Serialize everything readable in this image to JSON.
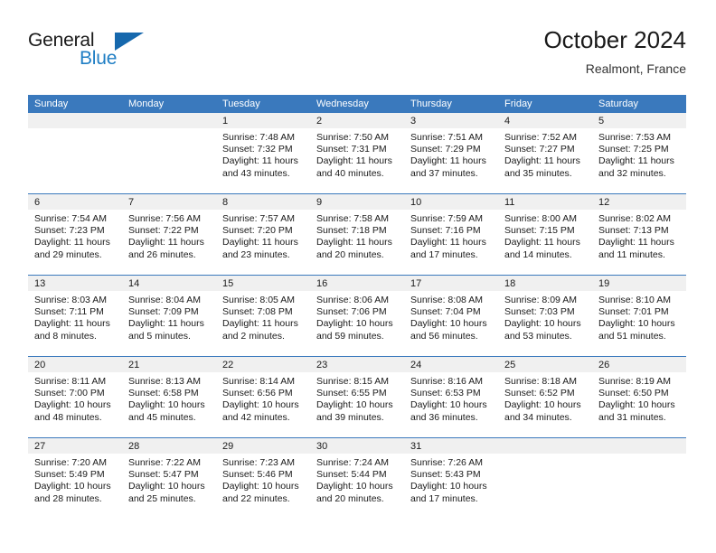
{
  "brand": {
    "word_one": "General",
    "word_two": "Blue",
    "logo_icon": "triangle-icon"
  },
  "header": {
    "title": "October 2024",
    "subtitle": "Realmont, France"
  },
  "calendar": {
    "weekday_headers": [
      "Sunday",
      "Monday",
      "Tuesday",
      "Wednesday",
      "Thursday",
      "Friday",
      "Saturday"
    ],
    "accent_color": "#3a79bd",
    "daynum_band_color": "#f0f0f0",
    "weeks": [
      [
        {
          "day": "",
          "sunrise": "",
          "sunset": "",
          "daylight_line1": "",
          "daylight_line2": ""
        },
        {
          "day": "",
          "sunrise": "",
          "sunset": "",
          "daylight_line1": "",
          "daylight_line2": ""
        },
        {
          "day": "1",
          "sunrise": "Sunrise: 7:48 AM",
          "sunset": "Sunset: 7:32 PM",
          "daylight_line1": "Daylight: 11 hours",
          "daylight_line2": "and 43 minutes."
        },
        {
          "day": "2",
          "sunrise": "Sunrise: 7:50 AM",
          "sunset": "Sunset: 7:31 PM",
          "daylight_line1": "Daylight: 11 hours",
          "daylight_line2": "and 40 minutes."
        },
        {
          "day": "3",
          "sunrise": "Sunrise: 7:51 AM",
          "sunset": "Sunset: 7:29 PM",
          "daylight_line1": "Daylight: 11 hours",
          "daylight_line2": "and 37 minutes."
        },
        {
          "day": "4",
          "sunrise": "Sunrise: 7:52 AM",
          "sunset": "Sunset: 7:27 PM",
          "daylight_line1": "Daylight: 11 hours",
          "daylight_line2": "and 35 minutes."
        },
        {
          "day": "5",
          "sunrise": "Sunrise: 7:53 AM",
          "sunset": "Sunset: 7:25 PM",
          "daylight_line1": "Daylight: 11 hours",
          "daylight_line2": "and 32 minutes."
        }
      ],
      [
        {
          "day": "6",
          "sunrise": "Sunrise: 7:54 AM",
          "sunset": "Sunset: 7:23 PM",
          "daylight_line1": "Daylight: 11 hours",
          "daylight_line2": "and 29 minutes."
        },
        {
          "day": "7",
          "sunrise": "Sunrise: 7:56 AM",
          "sunset": "Sunset: 7:22 PM",
          "daylight_line1": "Daylight: 11 hours",
          "daylight_line2": "and 26 minutes."
        },
        {
          "day": "8",
          "sunrise": "Sunrise: 7:57 AM",
          "sunset": "Sunset: 7:20 PM",
          "daylight_line1": "Daylight: 11 hours",
          "daylight_line2": "and 23 minutes."
        },
        {
          "day": "9",
          "sunrise": "Sunrise: 7:58 AM",
          "sunset": "Sunset: 7:18 PM",
          "daylight_line1": "Daylight: 11 hours",
          "daylight_line2": "and 20 minutes."
        },
        {
          "day": "10",
          "sunrise": "Sunrise: 7:59 AM",
          "sunset": "Sunset: 7:16 PM",
          "daylight_line1": "Daylight: 11 hours",
          "daylight_line2": "and 17 minutes."
        },
        {
          "day": "11",
          "sunrise": "Sunrise: 8:00 AM",
          "sunset": "Sunset: 7:15 PM",
          "daylight_line1": "Daylight: 11 hours",
          "daylight_line2": "and 14 minutes."
        },
        {
          "day": "12",
          "sunrise": "Sunrise: 8:02 AM",
          "sunset": "Sunset: 7:13 PM",
          "daylight_line1": "Daylight: 11 hours",
          "daylight_line2": "and 11 minutes."
        }
      ],
      [
        {
          "day": "13",
          "sunrise": "Sunrise: 8:03 AM",
          "sunset": "Sunset: 7:11 PM",
          "daylight_line1": "Daylight: 11 hours",
          "daylight_line2": "and 8 minutes."
        },
        {
          "day": "14",
          "sunrise": "Sunrise: 8:04 AM",
          "sunset": "Sunset: 7:09 PM",
          "daylight_line1": "Daylight: 11 hours",
          "daylight_line2": "and 5 minutes."
        },
        {
          "day": "15",
          "sunrise": "Sunrise: 8:05 AM",
          "sunset": "Sunset: 7:08 PM",
          "daylight_line1": "Daylight: 11 hours",
          "daylight_line2": "and 2 minutes."
        },
        {
          "day": "16",
          "sunrise": "Sunrise: 8:06 AM",
          "sunset": "Sunset: 7:06 PM",
          "daylight_line1": "Daylight: 10 hours",
          "daylight_line2": "and 59 minutes."
        },
        {
          "day": "17",
          "sunrise": "Sunrise: 8:08 AM",
          "sunset": "Sunset: 7:04 PM",
          "daylight_line1": "Daylight: 10 hours",
          "daylight_line2": "and 56 minutes."
        },
        {
          "day": "18",
          "sunrise": "Sunrise: 8:09 AM",
          "sunset": "Sunset: 7:03 PM",
          "daylight_line1": "Daylight: 10 hours",
          "daylight_line2": "and 53 minutes."
        },
        {
          "day": "19",
          "sunrise": "Sunrise: 8:10 AM",
          "sunset": "Sunset: 7:01 PM",
          "daylight_line1": "Daylight: 10 hours",
          "daylight_line2": "and 51 minutes."
        }
      ],
      [
        {
          "day": "20",
          "sunrise": "Sunrise: 8:11 AM",
          "sunset": "Sunset: 7:00 PM",
          "daylight_line1": "Daylight: 10 hours",
          "daylight_line2": "and 48 minutes."
        },
        {
          "day": "21",
          "sunrise": "Sunrise: 8:13 AM",
          "sunset": "Sunset: 6:58 PM",
          "daylight_line1": "Daylight: 10 hours",
          "daylight_line2": "and 45 minutes."
        },
        {
          "day": "22",
          "sunrise": "Sunrise: 8:14 AM",
          "sunset": "Sunset: 6:56 PM",
          "daylight_line1": "Daylight: 10 hours",
          "daylight_line2": "and 42 minutes."
        },
        {
          "day": "23",
          "sunrise": "Sunrise: 8:15 AM",
          "sunset": "Sunset: 6:55 PM",
          "daylight_line1": "Daylight: 10 hours",
          "daylight_line2": "and 39 minutes."
        },
        {
          "day": "24",
          "sunrise": "Sunrise: 8:16 AM",
          "sunset": "Sunset: 6:53 PM",
          "daylight_line1": "Daylight: 10 hours",
          "daylight_line2": "and 36 minutes."
        },
        {
          "day": "25",
          "sunrise": "Sunrise: 8:18 AM",
          "sunset": "Sunset: 6:52 PM",
          "daylight_line1": "Daylight: 10 hours",
          "daylight_line2": "and 34 minutes."
        },
        {
          "day": "26",
          "sunrise": "Sunrise: 8:19 AM",
          "sunset": "Sunset: 6:50 PM",
          "daylight_line1": "Daylight: 10 hours",
          "daylight_line2": "and 31 minutes."
        }
      ],
      [
        {
          "day": "27",
          "sunrise": "Sunrise: 7:20 AM",
          "sunset": "Sunset: 5:49 PM",
          "daylight_line1": "Daylight: 10 hours",
          "daylight_line2": "and 28 minutes."
        },
        {
          "day": "28",
          "sunrise": "Sunrise: 7:22 AM",
          "sunset": "Sunset: 5:47 PM",
          "daylight_line1": "Daylight: 10 hours",
          "daylight_line2": "and 25 minutes."
        },
        {
          "day": "29",
          "sunrise": "Sunrise: 7:23 AM",
          "sunset": "Sunset: 5:46 PM",
          "daylight_line1": "Daylight: 10 hours",
          "daylight_line2": "and 22 minutes."
        },
        {
          "day": "30",
          "sunrise": "Sunrise: 7:24 AM",
          "sunset": "Sunset: 5:44 PM",
          "daylight_line1": "Daylight: 10 hours",
          "daylight_line2": "and 20 minutes."
        },
        {
          "day": "31",
          "sunrise": "Sunrise: 7:26 AM",
          "sunset": "Sunset: 5:43 PM",
          "daylight_line1": "Daylight: 10 hours",
          "daylight_line2": "and 17 minutes."
        },
        {
          "day": "",
          "sunrise": "",
          "sunset": "",
          "daylight_line1": "",
          "daylight_line2": ""
        },
        {
          "day": "",
          "sunrise": "",
          "sunset": "",
          "daylight_line1": "",
          "daylight_line2": ""
        }
      ]
    ]
  }
}
